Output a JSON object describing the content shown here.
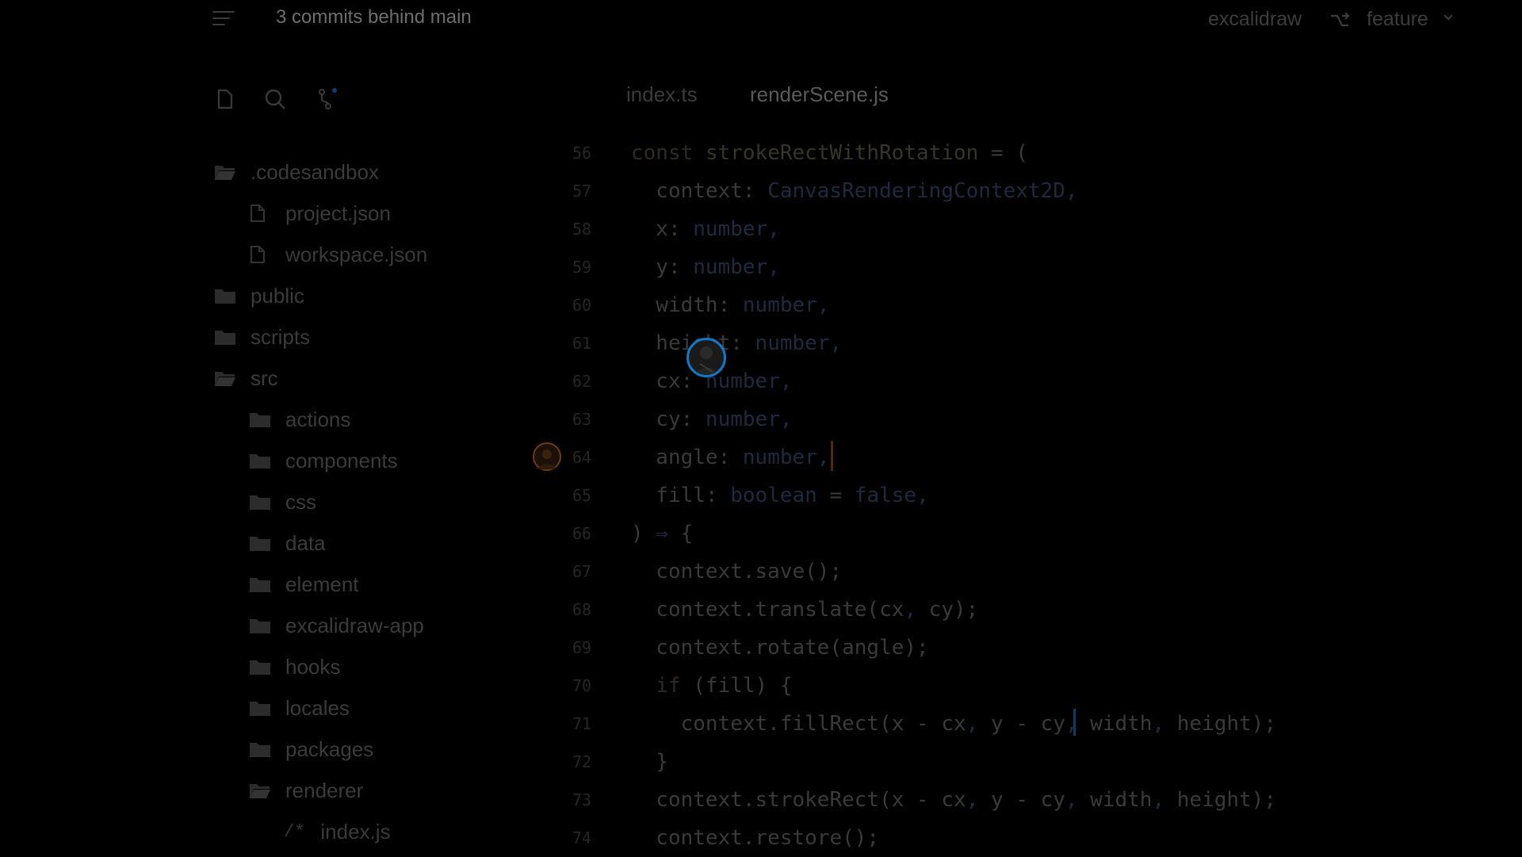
{
  "topbar": {
    "commits_text": "3 commits behind main",
    "repo_name": "excalidraw",
    "branch_name": "feature",
    "menu_icon": "hamburger-menu-icon",
    "branch_icon": "git-branch-icon",
    "chevron_icon": "chevron-down-icon"
  },
  "sidebar": {
    "toolbar": [
      {
        "icon": "file-icon"
      },
      {
        "icon": "search-icon"
      },
      {
        "icon": "source-control-icon"
      }
    ],
    "tree": [
      {
        "label": ".codesandbox",
        "kind": "folder-open",
        "depth": 0
      },
      {
        "label": "project.json",
        "kind": "file",
        "depth": 1
      },
      {
        "label": "workspace.json",
        "kind": "file",
        "depth": 1
      },
      {
        "label": "public",
        "kind": "folder",
        "depth": 0
      },
      {
        "label": "scripts",
        "kind": "folder",
        "depth": 0
      },
      {
        "label": "src",
        "kind": "folder-open",
        "depth": 0
      },
      {
        "label": "actions",
        "kind": "folder",
        "depth": 1
      },
      {
        "label": "components",
        "kind": "folder",
        "depth": 1
      },
      {
        "label": "css",
        "kind": "folder",
        "depth": 1
      },
      {
        "label": "data",
        "kind": "folder",
        "depth": 1
      },
      {
        "label": "element",
        "kind": "folder",
        "depth": 1
      },
      {
        "label": "excalidraw-app",
        "kind": "folder",
        "depth": 1
      },
      {
        "label": "hooks",
        "kind": "folder",
        "depth": 1
      },
      {
        "label": "locales",
        "kind": "folder",
        "depth": 1
      },
      {
        "label": "packages",
        "kind": "folder",
        "depth": 1
      },
      {
        "label": "renderer",
        "kind": "folder-open",
        "depth": 1
      },
      {
        "label": "index.js",
        "kind": "js-file",
        "depth": 2,
        "tag": "/*"
      }
    ]
  },
  "tabs": [
    {
      "label": "index.ts",
      "active": false
    },
    {
      "label": "renderScene.js",
      "active": true
    }
  ],
  "editor": {
    "lines": [
      {
        "num": "56",
        "text": "const strokeRectWithRotation = ("
      },
      {
        "num": "57",
        "text": "  context: CanvasRenderingContext2D,"
      },
      {
        "num": "58",
        "text": "  x: number,"
      },
      {
        "num": "59",
        "text": "  y: number,"
      },
      {
        "num": "60",
        "text": "  width: number,"
      },
      {
        "num": "61",
        "text": "  height: number,"
      },
      {
        "num": "62",
        "text": "  cx: number,"
      },
      {
        "num": "63",
        "text": "  cy: number,"
      },
      {
        "num": "64",
        "text": "  angle: number,"
      },
      {
        "num": "65",
        "text": "  fill: boolean = false,"
      },
      {
        "num": "66",
        "text": ") ⇒ {"
      },
      {
        "num": "67",
        "text": "  context.save();"
      },
      {
        "num": "68",
        "text": "  context.translate(cx, cy);"
      },
      {
        "num": "69",
        "text": "  context.rotate(angle);"
      },
      {
        "num": "70",
        "text": "  if (fill) {"
      },
      {
        "num": "71",
        "text": "    context.fillRect(x - cx, y - cy, width, height);"
      },
      {
        "num": "72",
        "text": "  }"
      },
      {
        "num": "73",
        "text": "  context.strokeRect(x - cx, y - cy, width, height);"
      },
      {
        "num": "74",
        "text": "  context.restore();"
      }
    ]
  },
  "collaborators": [
    {
      "name": "collaborator-avatar-cursor",
      "color": "#1478c8"
    },
    {
      "name": "collaborator-avatar-gutter",
      "color": "#6a3b14"
    }
  ]
}
